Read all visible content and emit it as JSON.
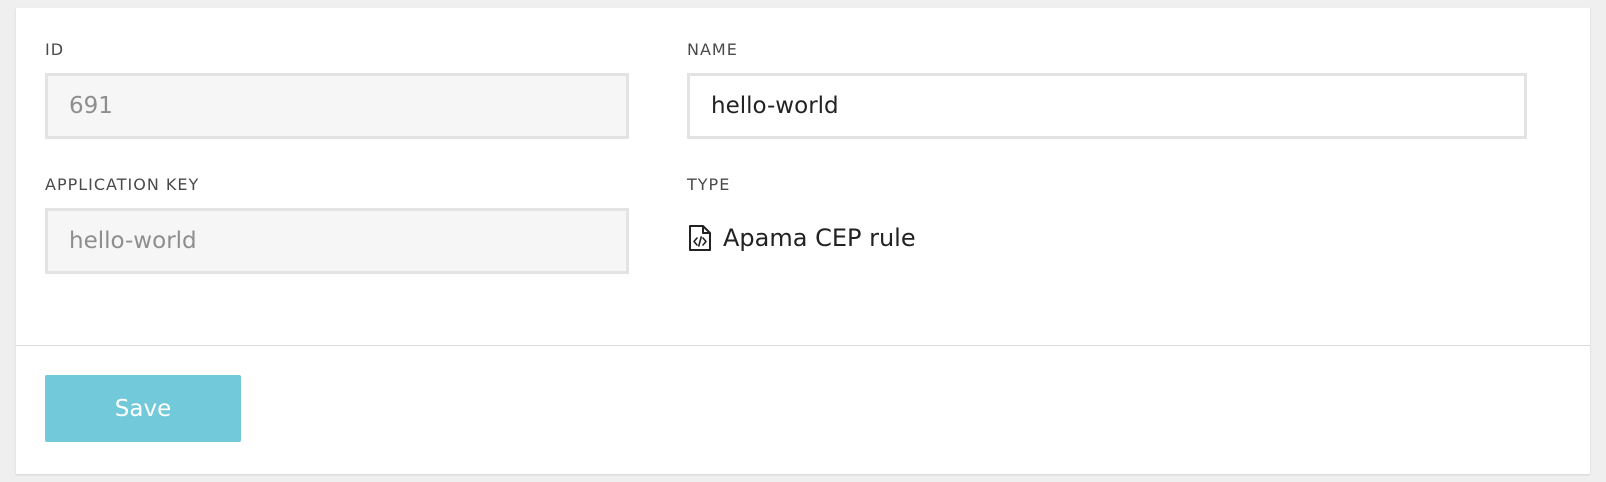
{
  "form": {
    "id": {
      "label": "ID",
      "value": "691"
    },
    "name": {
      "label": "NAME",
      "value": "hello-world"
    },
    "application_key": {
      "label": "APPLICATION KEY",
      "value": "hello-world"
    },
    "type": {
      "label": "TYPE",
      "value": "Apama CEP rule",
      "icon": "file-code-icon"
    }
  },
  "footer": {
    "save_label": "Save"
  },
  "colors": {
    "accent": "#71c9d9",
    "border": "#e3e3e3",
    "readonly_bg": "#f6f6f6"
  }
}
